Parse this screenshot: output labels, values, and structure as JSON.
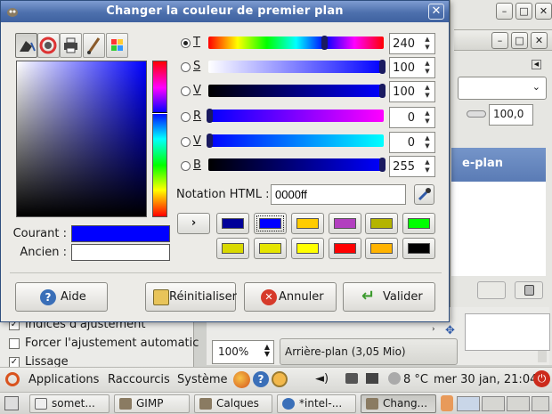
{
  "dialog": {
    "title": "Changer la couleur de premier plan",
    "current_label": "Courant :",
    "old_label": "Ancien :",
    "html_label": "Notation HTML :",
    "html_value": "0000ff",
    "current_color": "#0000ff",
    "old_color": "#ffffff",
    "channels": [
      {
        "key": "T",
        "value": "240",
        "selected": true
      },
      {
        "key": "S",
        "value": "100",
        "selected": false
      },
      {
        "key": "V",
        "value": "100",
        "selected": false
      },
      {
        "key": "R",
        "value": "0",
        "selected": false
      },
      {
        "key": "V",
        "value": "0",
        "selected": false
      },
      {
        "key": "B",
        "value": "255",
        "selected": false
      }
    ],
    "history_arrow": "›",
    "history_colors": [
      "#000099",
      "#0000ff",
      "#ffcc00",
      "#b23fbf",
      "#b4b400",
      "#00ff00",
      "#d9d900",
      "#e5e500",
      "#ffff00",
      "#ff0000",
      "#ffb300",
      "#000000"
    ],
    "buttons": {
      "help": "Aide",
      "reset": "Réinitialiser",
      "cancel": "Annuler",
      "ok": "Valider"
    }
  },
  "background": {
    "layer_name": "e-plan",
    "opacity_value": "100,0",
    "zoom_value": "100%",
    "status_text": "Arrière-plan (3,05 Mio)",
    "left_options": [
      {
        "label": "Indices d'ajustement",
        "checked": true
      },
      {
        "label": "Forcer l'ajustement automatic",
        "checked": false
      },
      {
        "label": "Lissage",
        "checked": true
      }
    ]
  },
  "top_panel": {
    "applications": "Applications",
    "places": "Raccourcis",
    "system": "Système",
    "weather": "8 °C",
    "clock": "mer 30 jan, 21:04"
  },
  "taskbar": {
    "tasks": [
      {
        "label": "somet...",
        "active": false
      },
      {
        "label": "GIMP",
        "active": false
      },
      {
        "label": "Calques",
        "active": false
      },
      {
        "label": "*intel-...",
        "active": false
      },
      {
        "label": "Chang...",
        "active": true
      }
    ]
  }
}
